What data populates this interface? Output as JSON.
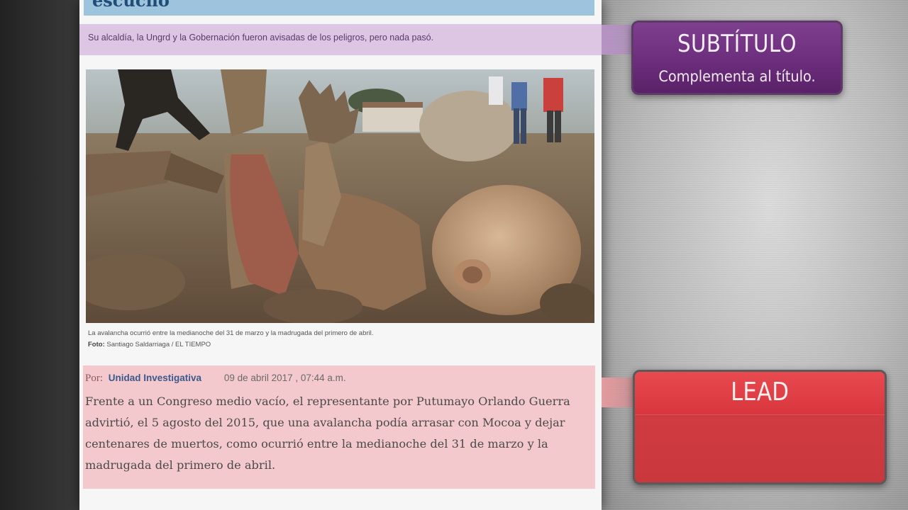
{
  "article": {
    "title_fragment": "escucho",
    "subtitle": "Su alcaldía, la Ungrd y la Gobernación fueron avisadas de los peligros, pero nada pasó.",
    "photo": {
      "caption": "La avalancha ocurrió entre la medianoche del 31 de marzo y la madrugada del primero de abril.",
      "credit_label": "Foto:",
      "credit_value": "Santiago Saldarriaga / EL TIEMPO"
    },
    "byline": {
      "prefix": "Por:",
      "author": "Unidad Investigativa",
      "date": "09 de abril 2017 , 07:44 a.m."
    },
    "lead_text": "Frente a un Congreso medio vacío, el representante por Putumayo Orlando Guerra advirtió, el 5 agosto del 2015, que una avalancha podía arrasar con Mocoa y dejar centenares de muertos, como ocurrió entre la medianoche del 31 de marzo y la madrugada del primero de abril."
  },
  "callouts": {
    "subtitle": {
      "heading": "SUBTÍTULO",
      "body": "Complementa al título."
    },
    "lead": {
      "heading": "LEAD"
    }
  },
  "colors": {
    "subtitle_highlight": "#ddc6e3",
    "lead_highlight": "#f4c9cd",
    "subtitle_callout": "#6d2f7e",
    "lead_callout": "#d63a40",
    "author_link": "#3a5a8a"
  }
}
